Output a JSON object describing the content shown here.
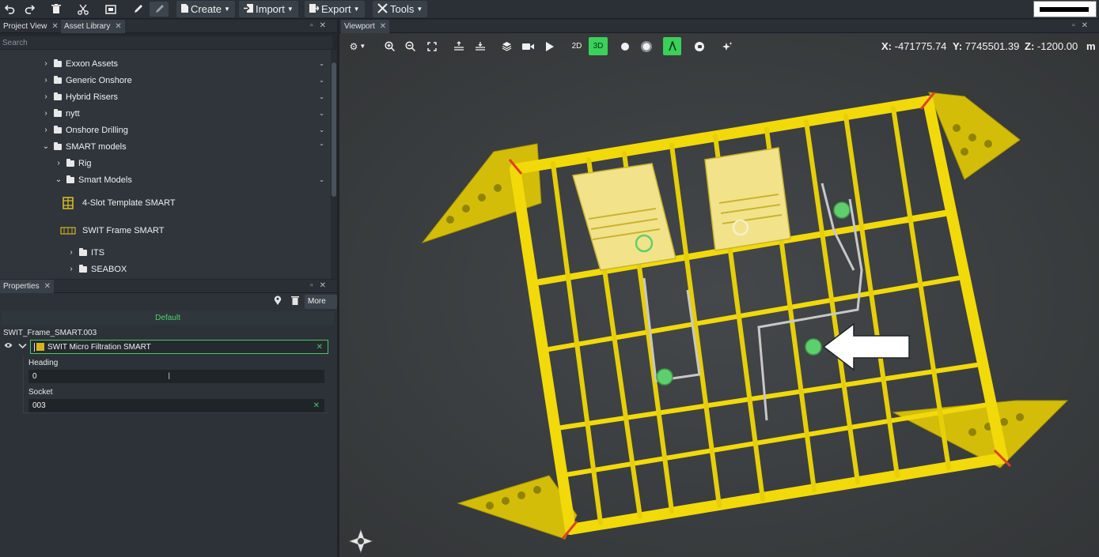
{
  "toolbar": {
    "icons": [
      "undo-icon",
      "redo-icon",
      "trash-icon",
      "scissors-icon",
      "frame-icon",
      "pencil-icon",
      "ruler-icon"
    ],
    "menus": [
      {
        "label": "Create",
        "icon": "file-icon"
      },
      {
        "label": "Import",
        "icon": "import-icon"
      },
      {
        "label": "Export",
        "icon": "export-icon"
      },
      {
        "label": "Tools",
        "icon": "tools-icon"
      }
    ]
  },
  "left_panel": {
    "tabs": [
      "Project View",
      "Asset Library"
    ],
    "active_tab": "Asset Library",
    "search_placeholder": "Search",
    "tree": [
      {
        "label": "Exxon Assets",
        "level": 0,
        "expanded": false
      },
      {
        "label": "Generic Onshore",
        "level": 0,
        "expanded": false
      },
      {
        "label": "Hybrid Risers",
        "level": 0,
        "expanded": false
      },
      {
        "label": "nytt",
        "level": 0,
        "expanded": false
      },
      {
        "label": "Onshore Drilling",
        "level": 0,
        "expanded": false
      },
      {
        "label": "SMART models",
        "level": 0,
        "expanded": true
      },
      {
        "label": "Rig",
        "level": 1,
        "expanded": false
      },
      {
        "label": "Smart Models",
        "level": 1,
        "expanded": true
      },
      {
        "label": "4-Slot Template SMART",
        "level": 2,
        "type": "asset"
      },
      {
        "label": "SWIT Frame SMART",
        "level": 2,
        "type": "asset"
      },
      {
        "label": "ITS",
        "level": 2,
        "expanded": false
      },
      {
        "label": "SEABOX",
        "level": 2,
        "expanded": false
      }
    ]
  },
  "properties": {
    "tab": "Properties",
    "more_label": "More",
    "default_label": "Default",
    "object_name": "SWIT_Frame_SMART.003",
    "model_value": "SWIT Micro Filtration SMART",
    "heading_label": "Heading",
    "heading_value": "0",
    "socket_label": "Socket",
    "socket_value": "003"
  },
  "viewport": {
    "tab": "Viewport",
    "mode_2d": "2D",
    "mode_3d": "3D",
    "active_mode": "3D",
    "coords": {
      "x_label": "X:",
      "x_value": "-471775.74",
      "y_label": "Y:",
      "y_value": "7745501.39",
      "z_label": "Z:",
      "z_value": "-1200.00",
      "unit": "m"
    }
  },
  "colors": {
    "accent_green": "#39d15a",
    "structure_yellow": "#f2d90a",
    "panel_bg": "#2f353b"
  }
}
